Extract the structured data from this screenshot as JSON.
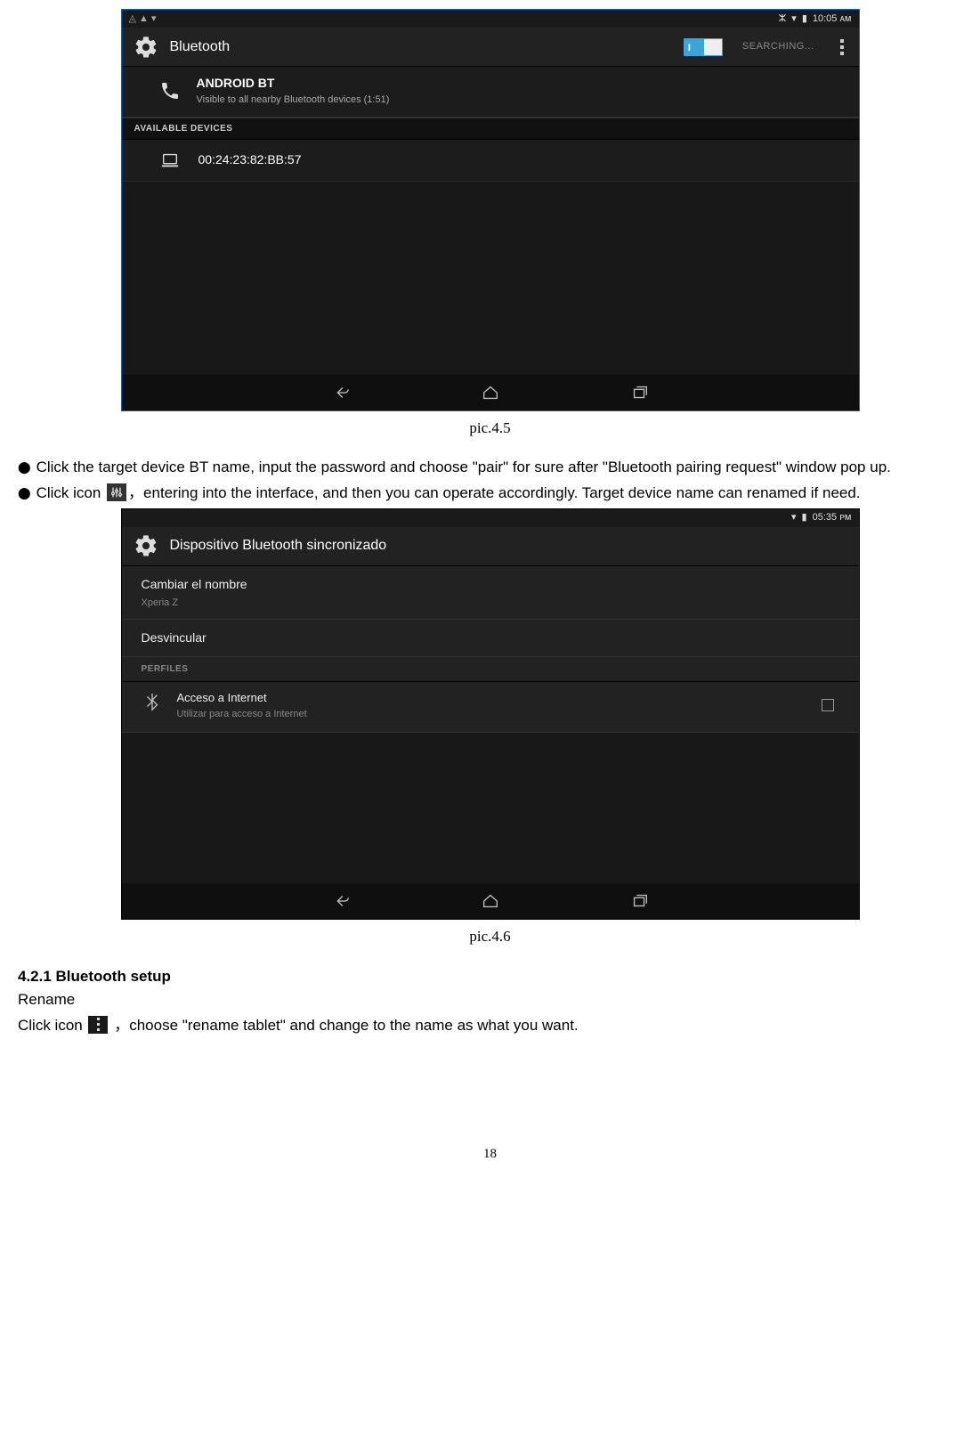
{
  "screenshot1": {
    "status": {
      "left_icons": "◬ ▲ ▾",
      "bt_icon": "ⵣ",
      "wifi_icon": "▾",
      "batt_icon": "▮",
      "time": "10:05 ᴀᴍ"
    },
    "appbar": {
      "title": "Bluetooth",
      "searching": "SEARCHING..."
    },
    "self_device": {
      "name": "ANDROID BT",
      "subtitle": "Visible to all nearby Bluetooth devices (1:51)"
    },
    "available_header": "AVAILABLE DEVICES",
    "device_mac": "00:24:23:82:BB:57"
  },
  "caption1": "pic.4.5",
  "bullets": {
    "b1": "Click the target device BT name, input the password and choose \"pair\" for sure after \"Bluetooth pairing request\" window pop up.",
    "b2a": "Click icon ",
    "b2b": "，entering into the interface, and then you can operate accordingly. Target device name can renamed if need."
  },
  "screenshot2": {
    "status": {
      "batt_icon": "▮",
      "wifi_icon": "▾",
      "time": "05:35 ᴘᴍ"
    },
    "appbar": {
      "title": "Dispositivo Bluetooth sincronizado"
    },
    "rename": {
      "title": "Cambiar el nombre",
      "value": "Xperia Z"
    },
    "unpair": "Desvincular",
    "profiles_header": "PERFILES",
    "internet": {
      "title": "Acceso a Internet",
      "sub": "Utilizar para acceso a Internet"
    }
  },
  "caption2": "pic.4.6",
  "section": {
    "heading": "4.2.1 Bluetooth setup",
    "rename_label": "Rename",
    "rename_text_a": "Click icon",
    "rename_text_b": " ，choose \"rename tablet\" and change to the name as what you want."
  },
  "page_number": "18"
}
